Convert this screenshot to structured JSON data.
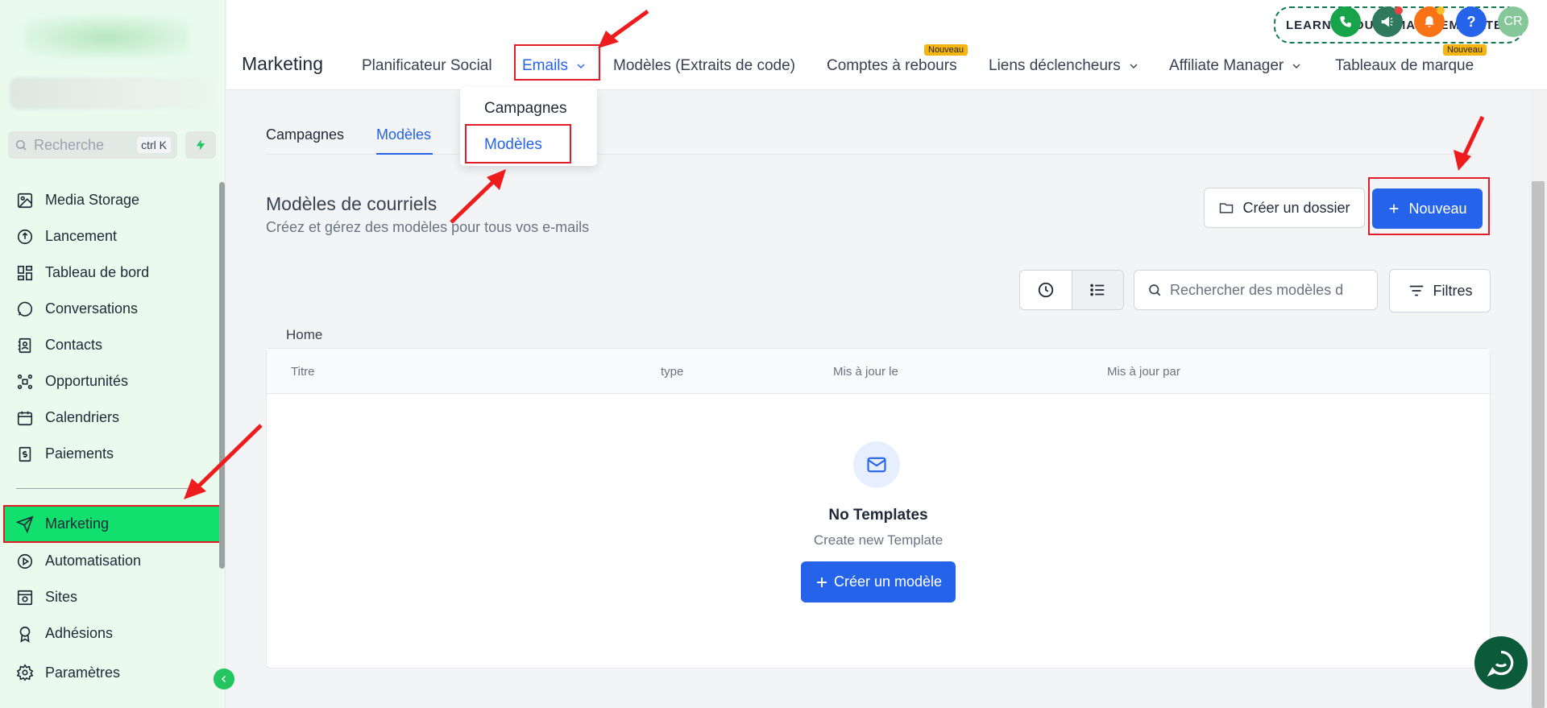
{
  "sidebar": {
    "search_placeholder": "Recherche",
    "search_shortcut": "ctrl K",
    "items": [
      {
        "label": "Media Storage",
        "icon": "image-icon"
      },
      {
        "label": "Lancement",
        "icon": "rocket-icon"
      },
      {
        "label": "Tableau de bord",
        "icon": "dashboard-icon"
      },
      {
        "label": "Conversations",
        "icon": "chat-icon"
      },
      {
        "label": "Contacts",
        "icon": "contacts-icon"
      },
      {
        "label": "Opportunités",
        "icon": "opportunities-icon"
      },
      {
        "label": "Calendriers",
        "icon": "calendar-icon"
      },
      {
        "label": "Paiements",
        "icon": "payments-icon"
      }
    ],
    "items2": [
      {
        "label": "Marketing",
        "icon": "send-icon"
      },
      {
        "label": "Automatisation",
        "icon": "automation-icon"
      },
      {
        "label": "Sites",
        "icon": "sites-icon"
      },
      {
        "label": "Adhésions",
        "icon": "badge-icon"
      }
    ],
    "settings_label": "Paramètres"
  },
  "topbar": {
    "learn_label": "LEARN ABOUT EMAIL TEMPLATES",
    "avatar_initials": "CR",
    "help_label": "?",
    "page_title": "Marketing",
    "tabs": [
      {
        "label": "Planificateur Social"
      },
      {
        "label": "Emails"
      },
      {
        "label": "Modèles (Extraits de code)"
      },
      {
        "label": "Comptes à rebours",
        "badge": "Nouveau"
      },
      {
        "label": "Liens déclencheurs"
      },
      {
        "label": "Affiliate Manager"
      },
      {
        "label": "Tableaux de marque",
        "badge": "Nouveau"
      }
    ]
  },
  "dropdown": {
    "items": [
      "Campagnes",
      "Modèles"
    ]
  },
  "main": {
    "subtabs": [
      "Campagnes",
      "Modèles"
    ],
    "section_title": "Modèles de courriels",
    "section_subtitle": "Créez et gérez des modèles pour tous vos e-mails",
    "create_folder_label": "Créer un dossier",
    "new_label": "Nouveau",
    "search_placeholder": "Rechercher des modèles d",
    "filter_label": "Filtres",
    "breadcrumb": "Home",
    "columns": [
      "Titre",
      "type",
      "Mis à jour le",
      "Mis à jour par"
    ],
    "empty_title": "No Templates",
    "empty_subtitle": "Create new Template",
    "create_template_label": "Créer un modèle"
  },
  "colors": {
    "accent": "#2563eb",
    "active_nav": "#11e06f",
    "highlight": "#e11d2a",
    "sidebar_bg": "#eafbee"
  }
}
